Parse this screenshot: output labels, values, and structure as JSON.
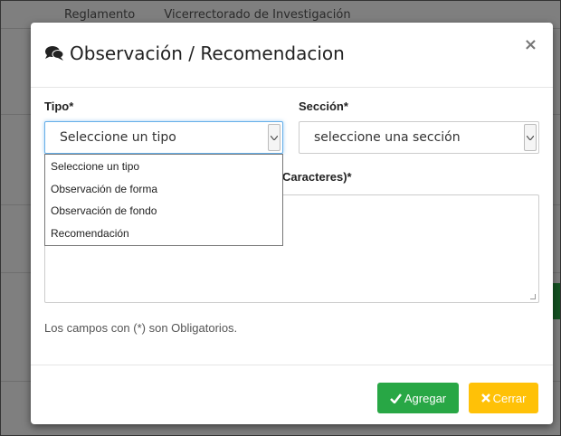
{
  "background": {
    "tabs": [
      "Reglamento",
      "Vicerrectorado de Investigación"
    ]
  },
  "modal": {
    "title": "Observación / Recomendacion",
    "close_label": "×",
    "icon": "comments-icon",
    "fields": {
      "tipo_label": "Tipo*",
      "tipo_selected": "Seleccione un tipo",
      "tipo_options": [
        "Seleccione un tipo",
        "Observación de forma",
        "Observación de fondo",
        "Recomendación"
      ],
      "seccion_label": "Sección*",
      "seccion_selected": "seleccione una sección",
      "textarea_label_visible": "Caracteres)*"
    },
    "required_note": "Los campos con (*) son Obligatorios.",
    "buttons": {
      "add_label": "Agregar",
      "close_label": "Cerrar"
    }
  },
  "colors": {
    "add_button": "#28a745",
    "close_button": "#ffc107",
    "focus_border": "#66afe9"
  }
}
